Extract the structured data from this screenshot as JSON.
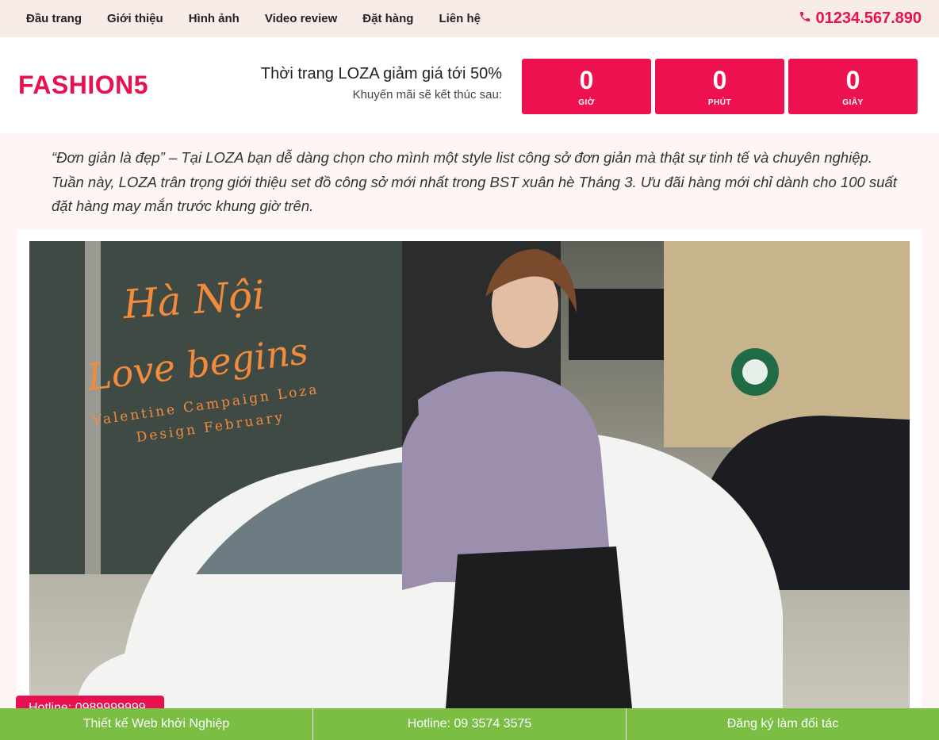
{
  "nav": {
    "items": [
      {
        "label": "Đầu trang"
      },
      {
        "label": "Giới thiệu"
      },
      {
        "label": "Hình ảnh"
      },
      {
        "label": "Video review"
      },
      {
        "label": "Đặt hàng"
      },
      {
        "label": "Liên hệ"
      }
    ],
    "phone": "01234.567.890"
  },
  "header": {
    "logo": "FASHION5",
    "promo_title": "Thời trang LOZA giảm giá tới 50%",
    "promo_sub": "Khuyến mãi sẽ kết thúc sau:",
    "countdown": [
      {
        "value": "0",
        "label": "GIỜ"
      },
      {
        "value": "0",
        "label": "PHÚT"
      },
      {
        "value": "0",
        "label": "GIÂY"
      }
    ]
  },
  "intro": {
    "text": "“Đơn giản là đẹp” – Tại LOZA bạn dễ dàng chọn cho mình một style list công sở đơn giản mà thật sự tinh tế và chuyên nghiệp. Tuần này, LOZA trân trọng giới thiệu set đồ công sở mới nhất trong BST xuân hè Tháng 3. Ưu đãi hàng mới chỉ dành cho 100 suất đặt hàng may mắn trước khung giờ trên."
  },
  "hero": {
    "line1": "Hà Nội",
    "line2": "Love begins",
    "line3": "Valentine Campaign Loza",
    "line4": "Design February"
  },
  "floating": {
    "hotline": "Hotline: 0989999999"
  },
  "bottom_bar": {
    "items": [
      {
        "label": "Thiết kế Web khởi Nghiệp"
      },
      {
        "label": "Hotline: 09 3574 3575"
      },
      {
        "label": "Đăng ký làm đối tác"
      }
    ]
  },
  "colors": {
    "accent": "#e8104f",
    "green": "#7bbe44",
    "topbar_bg": "#f8ece9"
  }
}
